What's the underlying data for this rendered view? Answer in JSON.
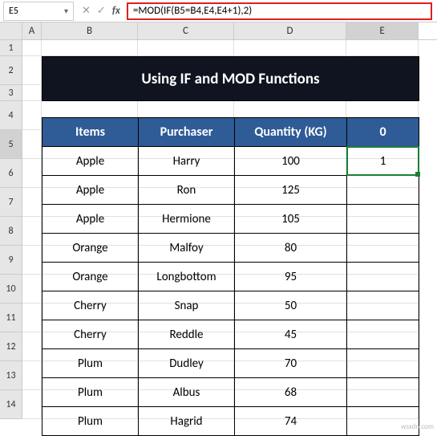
{
  "name_box": "E5",
  "formula": "=MOD(IF(B5=B4,E4,E4+1),2)",
  "col_headers": {
    "A": "A",
    "B": "B",
    "C": "C",
    "D": "D",
    "E": "E"
  },
  "row_headers": [
    "1",
    "2",
    "3",
    "4",
    "5",
    "6",
    "7",
    "8",
    "9",
    "10",
    "11",
    "12",
    "13",
    "14"
  ],
  "title": "Using  IF and MOD Functions",
  "table": {
    "headers": {
      "items": "Items",
      "purchaser": "Purchaser",
      "quantity": "Quantity (KG)",
      "extra": "0"
    },
    "rows": [
      {
        "items": "Apple",
        "purchaser": "Harry",
        "quantity": "100",
        "extra": "1"
      },
      {
        "items": "Apple",
        "purchaser": "Ron",
        "quantity": "125",
        "extra": ""
      },
      {
        "items": "Apple",
        "purchaser": "Hermione",
        "quantity": "105",
        "extra": ""
      },
      {
        "items": "Orange",
        "purchaser": "Malfoy",
        "quantity": "80",
        "extra": ""
      },
      {
        "items": "Orange",
        "purchaser": "Longbottom",
        "quantity": "95",
        "extra": ""
      },
      {
        "items": "Cherry",
        "purchaser": "Snap",
        "quantity": "50",
        "extra": ""
      },
      {
        "items": "Cherry",
        "purchaser": "Reddle",
        "quantity": "45",
        "extra": ""
      },
      {
        "items": "Plum",
        "purchaser": "Dudley",
        "quantity": "70",
        "extra": ""
      },
      {
        "items": "Plum",
        "purchaser": "Albus",
        "quantity": "68",
        "extra": ""
      },
      {
        "items": "Plum",
        "purchaser": "Hagrid",
        "quantity": "74",
        "extra": ""
      }
    ]
  },
  "watermark": "wsxdn.com"
}
